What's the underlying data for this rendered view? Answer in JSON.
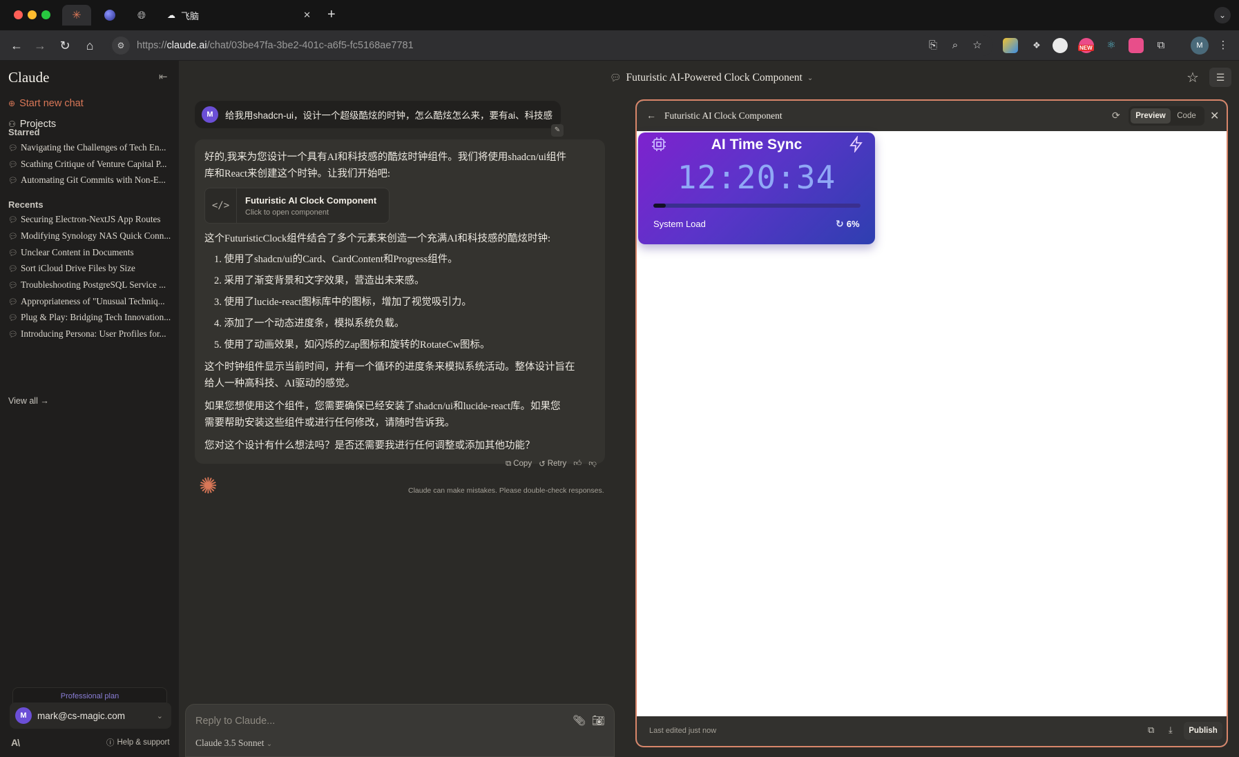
{
  "browser": {
    "tabs": [
      {
        "icon": "claude-sparkle-icon",
        "color": "#d97757"
      },
      {
        "icon": "planet-icon",
        "color": "#4a58d8"
      },
      {
        "icon": "globe-icon",
        "color": "#bbbbbb"
      },
      {
        "label": "飞脑",
        "icon": "feinao-icon"
      }
    ],
    "url_prefix": "https://",
    "url_host": "claude.ai",
    "url_path": "/chat/03be47fa-3be2-401c-a6f5-fc5168ae7781",
    "extension_badge": "NEW",
    "profile_initial": "M"
  },
  "sidebar": {
    "brand": "Claude",
    "start_new_chat": "Start new chat",
    "projects": "Projects",
    "starred_title": "Starred",
    "starred": [
      "Navigating the Challenges of Tech En...",
      "Scathing Critique of Venture Capital P...",
      "Automating Git Commits with Non-E..."
    ],
    "recents_title": "Recents",
    "recents": [
      "Securing Electron-NextJS App Routes",
      "Modifying Synology NAS Quick Conn...",
      "Unclear Content in Documents",
      "Sort iCloud Drive Files by Size",
      "Troubleshooting PostgreSQL Service ...",
      "Appropriateness of \"Unusual Techniq...",
      "Plug & Play: Bridging Tech Innovation...",
      "Introducing Persona: User Profiles for..."
    ],
    "view_all": "View all →",
    "plan": "Professional plan",
    "account_initial": "M",
    "account_email": "mark@cs-magic.com",
    "logo_text": "A\\",
    "help": "Help & support"
  },
  "header": {
    "chat_title": "Futuristic AI-Powered Clock Component"
  },
  "conversation": {
    "user_initial": "M",
    "user_message": "给我用shadcn-ui，设计一个超级酷炫的时钟，怎么酷炫怎么来，要有ai、科技感",
    "intro_line1": "好的,我来为您设计一个具有AI和科技感的酷炫时钟组件。我们将使用shadcn/ui组件",
    "intro_line2": "库和React来创建这个时钟。让我们开始吧:",
    "artifact_title": "Futuristic AI Clock Component",
    "artifact_subtitle": "Click to open component",
    "summary": "这个FuturisticClock组件结合了多个元素来创造一个充满AI和科技感的酷炫时钟:",
    "list": [
      "1. 使用了shadcn/ui的Card、CardContent和Progress组件。",
      "2. 采用了渐变背景和文字效果，营造出未来感。",
      "3. 使用了lucide-react图标库中的图标，增加了视觉吸引力。",
      "4. 添加了一个动态进度条，模拟系统负载。",
      "5. 使用了动画效果，如闪烁的Zap图标和旋转的RotateCw图标。"
    ],
    "para1_line1": "这个时钟组件显示当前时间，并有一个循环的进度条来模拟系统活动。整体设计旨在",
    "para1_line2": "给人一种高科技、AI驱动的感觉。",
    "para2_line1": "如果您想使用这个组件，您需要确保已经安装了shadcn/ui和lucide-react库。如果您",
    "para2_line2": "需要帮助安装这些组件或进行任何修改，请随时告诉我。",
    "question": "您对这个设计有什么想法吗？是否还需要我进行任何调整或添加其他功能？",
    "copy": "Copy",
    "retry": "Retry",
    "disclaimer": "Claude can make mistakes. Please double-check responses."
  },
  "composer": {
    "placeholder": "Reply to Claude...",
    "model": "Claude 3.5 Sonnet"
  },
  "artifact": {
    "title": "Futuristic AI Clock Component",
    "preview_tab": "Preview",
    "code_tab": "Code",
    "clock_title": "AI Time Sync",
    "time": "12:20:34",
    "load_label": "System Load",
    "load_value": "6%",
    "load_fraction": 0.06,
    "last_edited": "Last edited just now",
    "publish": "Publish"
  },
  "colors": {
    "accent": "#d97757",
    "panel_border": "#d9866a",
    "clock_gradient_start": "#7e22ce",
    "clock_gradient_end": "#2e3fb0",
    "clock_digits": "#90a8f6"
  }
}
